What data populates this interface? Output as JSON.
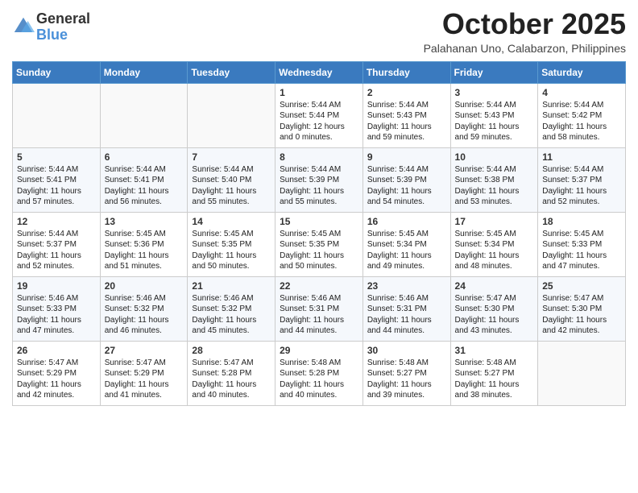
{
  "logo": {
    "general": "General",
    "blue": "Blue"
  },
  "title": "October 2025",
  "subtitle": "Palahanan Uno, Calabarzon, Philippines",
  "days_of_week": [
    "Sunday",
    "Monday",
    "Tuesday",
    "Wednesday",
    "Thursday",
    "Friday",
    "Saturday"
  ],
  "weeks": [
    [
      {
        "day": "",
        "info": ""
      },
      {
        "day": "",
        "info": ""
      },
      {
        "day": "",
        "info": ""
      },
      {
        "day": "1",
        "info": "Sunrise: 5:44 AM\nSunset: 5:44 PM\nDaylight: 12 hours\nand 0 minutes."
      },
      {
        "day": "2",
        "info": "Sunrise: 5:44 AM\nSunset: 5:43 PM\nDaylight: 11 hours\nand 59 minutes."
      },
      {
        "day": "3",
        "info": "Sunrise: 5:44 AM\nSunset: 5:43 PM\nDaylight: 11 hours\nand 59 minutes."
      },
      {
        "day": "4",
        "info": "Sunrise: 5:44 AM\nSunset: 5:42 PM\nDaylight: 11 hours\nand 58 minutes."
      }
    ],
    [
      {
        "day": "5",
        "info": "Sunrise: 5:44 AM\nSunset: 5:41 PM\nDaylight: 11 hours\nand 57 minutes."
      },
      {
        "day": "6",
        "info": "Sunrise: 5:44 AM\nSunset: 5:41 PM\nDaylight: 11 hours\nand 56 minutes."
      },
      {
        "day": "7",
        "info": "Sunrise: 5:44 AM\nSunset: 5:40 PM\nDaylight: 11 hours\nand 55 minutes."
      },
      {
        "day": "8",
        "info": "Sunrise: 5:44 AM\nSunset: 5:39 PM\nDaylight: 11 hours\nand 55 minutes."
      },
      {
        "day": "9",
        "info": "Sunrise: 5:44 AM\nSunset: 5:39 PM\nDaylight: 11 hours\nand 54 minutes."
      },
      {
        "day": "10",
        "info": "Sunrise: 5:44 AM\nSunset: 5:38 PM\nDaylight: 11 hours\nand 53 minutes."
      },
      {
        "day": "11",
        "info": "Sunrise: 5:44 AM\nSunset: 5:37 PM\nDaylight: 11 hours\nand 52 minutes."
      }
    ],
    [
      {
        "day": "12",
        "info": "Sunrise: 5:44 AM\nSunset: 5:37 PM\nDaylight: 11 hours\nand 52 minutes."
      },
      {
        "day": "13",
        "info": "Sunrise: 5:45 AM\nSunset: 5:36 PM\nDaylight: 11 hours\nand 51 minutes."
      },
      {
        "day": "14",
        "info": "Sunrise: 5:45 AM\nSunset: 5:35 PM\nDaylight: 11 hours\nand 50 minutes."
      },
      {
        "day": "15",
        "info": "Sunrise: 5:45 AM\nSunset: 5:35 PM\nDaylight: 11 hours\nand 50 minutes."
      },
      {
        "day": "16",
        "info": "Sunrise: 5:45 AM\nSunset: 5:34 PM\nDaylight: 11 hours\nand 49 minutes."
      },
      {
        "day": "17",
        "info": "Sunrise: 5:45 AM\nSunset: 5:34 PM\nDaylight: 11 hours\nand 48 minutes."
      },
      {
        "day": "18",
        "info": "Sunrise: 5:45 AM\nSunset: 5:33 PM\nDaylight: 11 hours\nand 47 minutes."
      }
    ],
    [
      {
        "day": "19",
        "info": "Sunrise: 5:46 AM\nSunset: 5:33 PM\nDaylight: 11 hours\nand 47 minutes."
      },
      {
        "day": "20",
        "info": "Sunrise: 5:46 AM\nSunset: 5:32 PM\nDaylight: 11 hours\nand 46 minutes."
      },
      {
        "day": "21",
        "info": "Sunrise: 5:46 AM\nSunset: 5:32 PM\nDaylight: 11 hours\nand 45 minutes."
      },
      {
        "day": "22",
        "info": "Sunrise: 5:46 AM\nSunset: 5:31 PM\nDaylight: 11 hours\nand 44 minutes."
      },
      {
        "day": "23",
        "info": "Sunrise: 5:46 AM\nSunset: 5:31 PM\nDaylight: 11 hours\nand 44 minutes."
      },
      {
        "day": "24",
        "info": "Sunrise: 5:47 AM\nSunset: 5:30 PM\nDaylight: 11 hours\nand 43 minutes."
      },
      {
        "day": "25",
        "info": "Sunrise: 5:47 AM\nSunset: 5:30 PM\nDaylight: 11 hours\nand 42 minutes."
      }
    ],
    [
      {
        "day": "26",
        "info": "Sunrise: 5:47 AM\nSunset: 5:29 PM\nDaylight: 11 hours\nand 42 minutes."
      },
      {
        "day": "27",
        "info": "Sunrise: 5:47 AM\nSunset: 5:29 PM\nDaylight: 11 hours\nand 41 minutes."
      },
      {
        "day": "28",
        "info": "Sunrise: 5:47 AM\nSunset: 5:28 PM\nDaylight: 11 hours\nand 40 minutes."
      },
      {
        "day": "29",
        "info": "Sunrise: 5:48 AM\nSunset: 5:28 PM\nDaylight: 11 hours\nand 40 minutes."
      },
      {
        "day": "30",
        "info": "Sunrise: 5:48 AM\nSunset: 5:27 PM\nDaylight: 11 hours\nand 39 minutes."
      },
      {
        "day": "31",
        "info": "Sunrise: 5:48 AM\nSunset: 5:27 PM\nDaylight: 11 hours\nand 38 minutes."
      },
      {
        "day": "",
        "info": ""
      }
    ]
  ]
}
